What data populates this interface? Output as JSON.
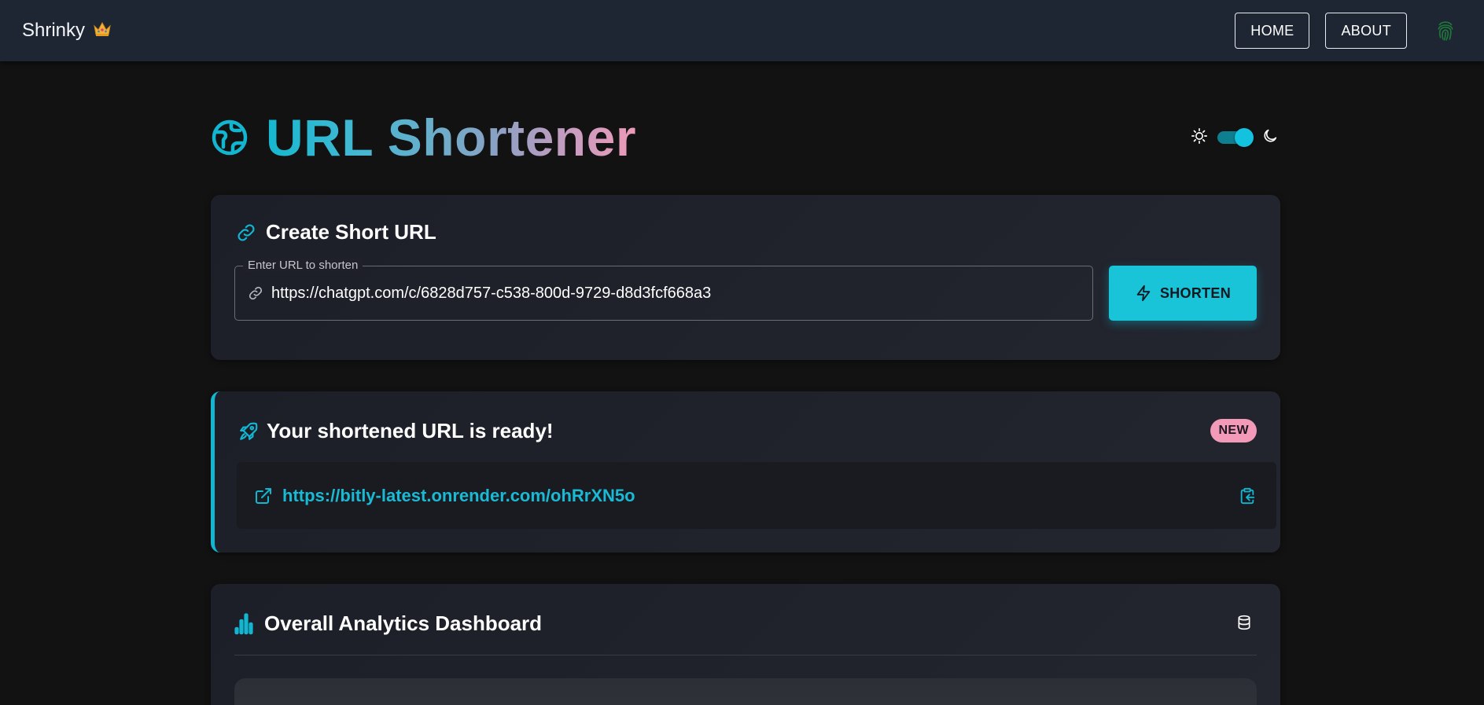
{
  "app": {
    "name": "Shrinky",
    "crown_icon": "crown-icon"
  },
  "nav": {
    "home_label": "HOME",
    "about_label": "ABOUT",
    "profile_icon": "fingerprint-icon"
  },
  "header": {
    "title": "URL Shortener",
    "title_icon": "globe-icon",
    "theme": {
      "light_icon": "sun-icon",
      "dark_icon": "moon-icon",
      "dark_mode_enabled": true
    }
  },
  "create": {
    "title": "Create Short URL",
    "field_label": "Enter URL to shorten",
    "url_value": "https://chatgpt.com/c/6828d757-c538-800d-9729-d8d3fcf668a3",
    "button_label": "SHORTEN"
  },
  "result": {
    "title": "Your shortened URL is ready!",
    "badge": "NEW",
    "short_url": "https://bitly-latest.onrender.com/ohRrXN5o"
  },
  "analytics": {
    "title": "Overall Analytics Dashboard"
  },
  "colors": {
    "accent": "#13c2de",
    "badge": "#f29ab8",
    "topbar": "#1e2633",
    "background": "#121212"
  }
}
